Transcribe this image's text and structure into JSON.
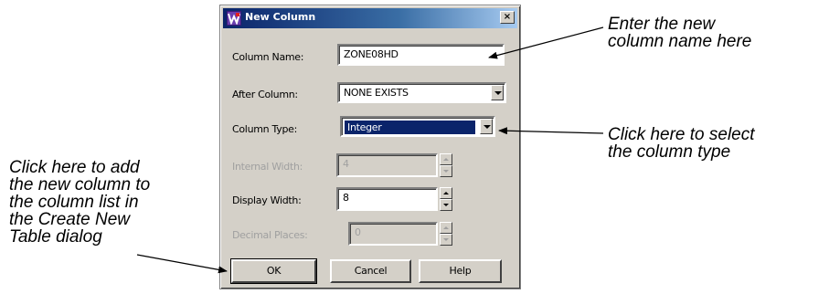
{
  "dialog": {
    "title": "New Column",
    "close_label": "×",
    "fields": {
      "column_name": {
        "label": "Column Name:",
        "value": "ZONE08HD"
      },
      "after_column": {
        "label": "After Column:",
        "value": "NONE EXISTS"
      },
      "column_type": {
        "label": "Column Type:",
        "value": "Integer"
      },
      "internal_width": {
        "label": "Internal Width:",
        "value": "4"
      },
      "display_width": {
        "label": "Display Width:",
        "value": "8"
      },
      "decimal_places": {
        "label": "Decimal Places:",
        "value": "0"
      }
    },
    "buttons": {
      "ok": "OK",
      "cancel": "Cancel",
      "help": "Help"
    }
  },
  "annotations": {
    "name_hint": [
      "Enter the new",
      "column name here"
    ],
    "type_hint": [
      "Click here to select",
      "the column type"
    ],
    "ok_hint": [
      "Click here to add",
      "the new column to",
      "the column list in",
      "the Create New",
      "Table dialog"
    ]
  }
}
